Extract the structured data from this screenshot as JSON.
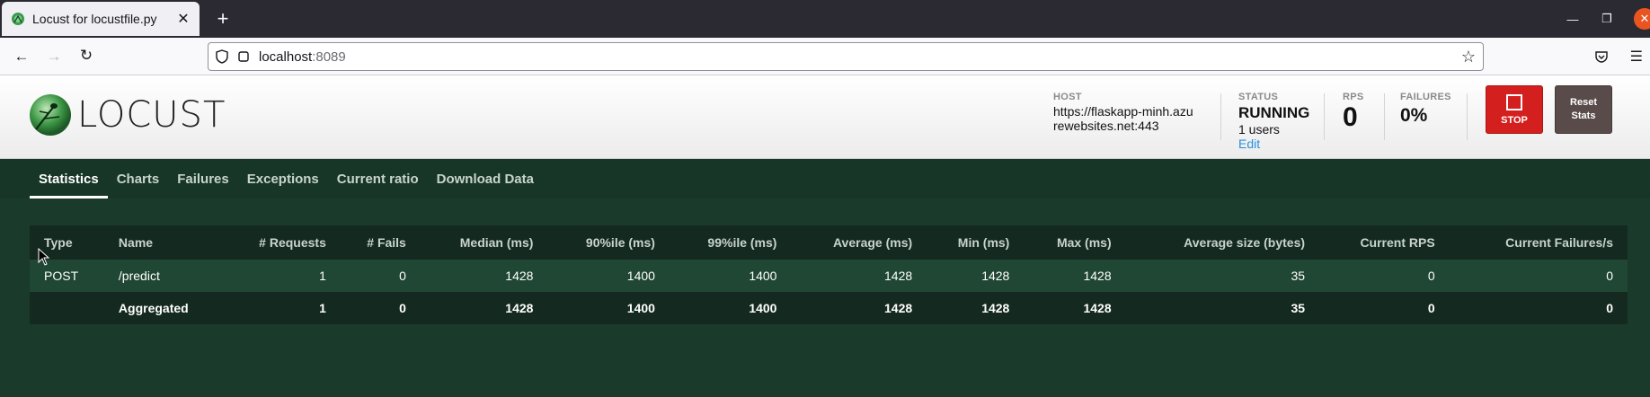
{
  "browser": {
    "tab_title": "Locust for locustfile.py",
    "url_host": "localhost",
    "url_port": ":8089"
  },
  "locust": {
    "logo_text": "LOCUST",
    "host_label": "HOST",
    "host_value": "https://flaskapp-minh.azurewebsites.net:443",
    "status_label": "STATUS",
    "status_value": "RUNNING",
    "users": "1 users",
    "edit_label": "Edit",
    "rps_label": "RPS",
    "rps_value": "0",
    "failures_label": "FAILURES",
    "failures_value": "0%",
    "stop_label": "STOP",
    "reset_label_1": "Reset",
    "reset_label_2": "Stats"
  },
  "nav": {
    "items": [
      {
        "label": "Statistics",
        "active": true
      },
      {
        "label": "Charts"
      },
      {
        "label": "Failures"
      },
      {
        "label": "Exceptions"
      },
      {
        "label": "Current ratio"
      },
      {
        "label": "Download Data"
      }
    ]
  },
  "table": {
    "headers": [
      "Type",
      "Name",
      "# Requests",
      "# Fails",
      "Median (ms)",
      "90%ile (ms)",
      "99%ile (ms)",
      "Average (ms)",
      "Min (ms)",
      "Max (ms)",
      "Average size (bytes)",
      "Current RPS",
      "Current Failures/s"
    ],
    "rows": [
      [
        "POST",
        "/predict",
        "1",
        "0",
        "1428",
        "1400",
        "1400",
        "1428",
        "1428",
        "1428",
        "35",
        "0",
        "0"
      ]
    ],
    "aggregated": [
      "",
      "Aggregated",
      "1",
      "0",
      "1428",
      "1400",
      "1400",
      "1428",
      "1428",
      "1428",
      "35",
      "0",
      "0"
    ]
  },
  "colors": {
    "stop_button": "#d41f1f",
    "reset_button": "#5a4b4b",
    "nav_bg": "#173627",
    "main_bg": "#1a3a2c",
    "row_bg": "#204734"
  }
}
